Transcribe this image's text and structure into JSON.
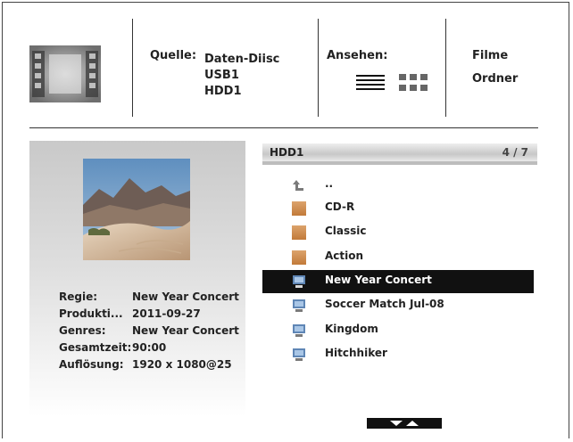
{
  "header": {
    "source_label": "Quelle:",
    "sources": [
      "Daten-Diisc",
      "USB1",
      "HDD1"
    ],
    "view_label": "Ansehen:",
    "categories": [
      "Filme",
      "Ordner"
    ]
  },
  "info": {
    "rows": [
      {
        "label": "Regie:",
        "value": "New Year Concert"
      },
      {
        "label": "Produkti...",
        "value": "2011-09-27"
      },
      {
        "label": "Genres:",
        "value": "New Year Concert"
      },
      {
        "label": "Gesamtzeit:",
        "value": "90:00"
      },
      {
        "label": "Auflösung:",
        "value": "1920 x 1080@25"
      }
    ]
  },
  "list": {
    "title": "HDD1",
    "count": "4 / 7",
    "items": [
      {
        "name": "..",
        "icon": "up-arrow-icon"
      },
      {
        "name": "CD-R",
        "icon": "folder-icon"
      },
      {
        "name": "Classic",
        "icon": "folder-icon"
      },
      {
        "name": "Action",
        "icon": "folder-icon"
      },
      {
        "name": "New Year Concert",
        "icon": "video-file-icon",
        "selected": true
      },
      {
        "name": "Soccer Match Jul-08",
        "icon": "video-file-icon"
      },
      {
        "name": "Kingdom",
        "icon": "video-file-icon"
      },
      {
        "name": "Hitchhiker",
        "icon": "video-file-icon"
      }
    ]
  }
}
